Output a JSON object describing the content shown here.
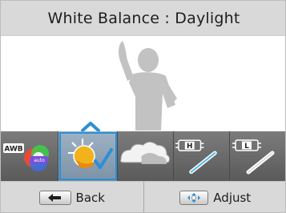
{
  "title": {
    "label": "White Balance",
    "separator": " : ",
    "value": "Daylight"
  },
  "options": [
    {
      "name": "AWB",
      "badge": "AWB",
      "badge_sub": "auto",
      "icon": "auto-white-balance-icon",
      "selected": false
    },
    {
      "name": "Daylight",
      "icon": "daylight-sun-icon",
      "selected": true
    },
    {
      "name": "Cloudy",
      "icon": "cloudy-icon",
      "selected": false
    },
    {
      "name": "Fluorescent H",
      "badge": "H",
      "icon": "fluorescent-h-icon",
      "selected": false
    },
    {
      "name": "Fluorescent L",
      "badge": "L",
      "icon": "fluorescent-l-icon",
      "selected": false
    }
  ],
  "footer": {
    "back": {
      "label": "Back",
      "icon": "return-arrow-icon"
    },
    "adjust": {
      "label": "Adjust",
      "icon": "four-way-nav-icon"
    }
  },
  "colors": {
    "selection_outline": "#2c8fd6",
    "bars": "#d9d9d9",
    "strip": "#6e6e6e"
  }
}
